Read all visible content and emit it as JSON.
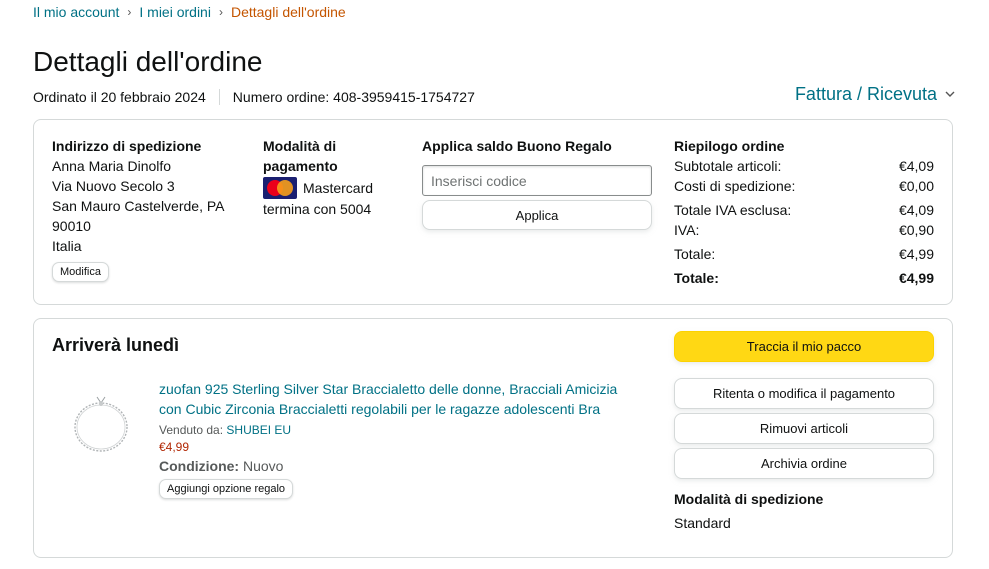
{
  "breadcrumb": {
    "items": [
      "Il mio account",
      "I miei ordini"
    ],
    "current": "Dettagli dell'ordine",
    "separator": "›"
  },
  "page_title": "Dettagli dell'ordine",
  "order_meta": {
    "ordered_on": "Ordinato il 20 febbraio 2024",
    "order_number": "Numero ordine: 408-3959415-1754727"
  },
  "invoice": {
    "label": "Fattura / Ricevuta",
    "icon": "chevron-down-icon"
  },
  "shipping_address": {
    "heading": "Indirizzo di spedizione",
    "lines": [
      "Anna Maria Dinolfo",
      "Via Nuovo Secolo 3",
      "San Mauro Castelverde, PA",
      "90010",
      "Italia"
    ],
    "edit_label": "Modifica"
  },
  "payment": {
    "heading_line1": "Modalità di",
    "heading_line2": "pagamento",
    "card_brand": "Mastercard",
    "card_ending": "termina con 5004"
  },
  "gift_card": {
    "heading": "Applica saldo Buono Regalo",
    "placeholder": "Inserisci codice",
    "apply_label": "Applica"
  },
  "summary": {
    "heading": "Riepilogo ordine",
    "rows": [
      {
        "label": "Subtotale articoli:",
        "value": "€4,09"
      },
      {
        "label": "Costi di spedizione:",
        "value": "€0,00"
      },
      {
        "label": "Totale IVA esclusa:",
        "value": "€4,09"
      },
      {
        "label": "IVA:",
        "value": "€0,90"
      },
      {
        "label": "Totale:",
        "value": "€4,99"
      }
    ],
    "grand_total": {
      "label": "Totale:",
      "value": "€4,99"
    }
  },
  "shipment": {
    "arrival": "Arriverà lunedì",
    "product": {
      "title": "zuofan 925 Sterling Silver Star Braccialetto delle donne, Bracciali Amicizia con Cubic Zirconia Braccialetti regolabili per le ragazze adolescenti Bra",
      "sold_by_label": "Venduto da:",
      "seller": "SHUBEI EU",
      "price": "€4,99",
      "condition_label": "Condizione:",
      "condition_value": "Nuovo",
      "gift_option_label": "Aggiungi opzione regalo"
    },
    "actions": {
      "track": "Traccia il mio pacco",
      "retry_payment": "Ritenta o modifica il pagamento",
      "remove_items": "Rimuovi articoli",
      "archive": "Archivia ordine"
    },
    "shipping_mode": {
      "heading": "Modalità di spedizione",
      "value": "Standard"
    }
  },
  "colors": {
    "link": "#007185",
    "breadcrumb_current": "#c45500",
    "price": "#b12704",
    "primary_button": "#ffd814",
    "border": "#d5d9d9"
  }
}
